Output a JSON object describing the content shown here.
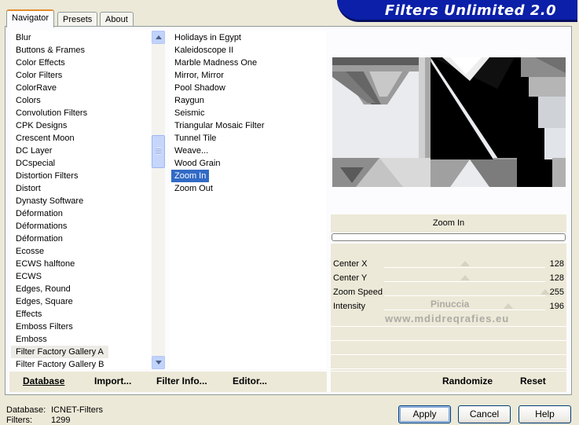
{
  "app_title": "Filters Unlimited 2.0",
  "tabs": [
    {
      "label": "Navigator",
      "active": true
    },
    {
      "label": "Presets",
      "active": false
    },
    {
      "label": "About",
      "active": false
    }
  ],
  "categories": [
    "Blur",
    "Buttons & Frames",
    "Color Effects",
    "Color Filters",
    "ColorRave",
    "Colors",
    "Convolution Filters",
    "CPK Designs",
    "Crescent Moon",
    "DC Layer",
    "DCspecial",
    "Distortion Filters",
    "Distort",
    "Dynasty Software",
    "Déformation",
    "Déformations",
    "Déformation",
    "Ecosse",
    "ECWS halftone",
    "ECWS",
    "Edges, Round",
    "Edges, Square",
    "Effects",
    "Emboss Filters",
    "Emboss",
    "Filter Factory Gallery A",
    "Filter Factory Gallery B"
  ],
  "selected_category_index": 25,
  "filters": [
    "Holidays in Egypt",
    "Kaleidoscope II",
    "Marble Madness One",
    "Mirror, Mirror",
    "Pool Shadow",
    "Raygun",
    "Seismic",
    "Triangular Mosaic Filter",
    "Tunnel Tile",
    "Weave...",
    "Wood Grain",
    "Zoom In",
    "Zoom Out"
  ],
  "selected_filter_index": 11,
  "selected_filter_name": "Zoom In",
  "params": [
    {
      "name": "Center X",
      "value": "128",
      "level": 0.5
    },
    {
      "name": "Center Y",
      "value": "128",
      "level": 0.5
    },
    {
      "name": "Zoom Speed",
      "value": "255",
      "level": 1.0
    },
    {
      "name": "Intensity",
      "value": "196",
      "level": 0.77
    }
  ],
  "watermark": {
    "line1": "Pinuccia",
    "line2": "www.mdidreqrafies.eu"
  },
  "bottom_bar": {
    "database": "Database",
    "import": "Import...",
    "filter_info": "Filter Info...",
    "editor": "Editor...",
    "randomize": "Randomize",
    "reset": "Reset"
  },
  "footer": {
    "database_label": "Database:",
    "database_value": "ICNET-Filters",
    "filters_label": "Filters:",
    "filters_value": "1299"
  },
  "dialog_buttons": {
    "apply": "Apply",
    "cancel": "Cancel",
    "help": "Help"
  }
}
